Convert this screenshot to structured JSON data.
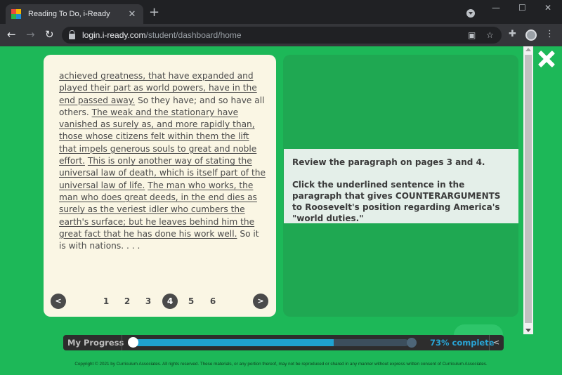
{
  "browser": {
    "tab_title": "Reading To Do, i-Ready",
    "tab_close": "✕",
    "new_tab": "+",
    "url_host": "login.i-ready.com",
    "url_path": "/student/dashboard/home",
    "window_controls": [
      "—",
      "☐",
      "✕"
    ]
  },
  "passage": {
    "segments": [
      {
        "text": "achieved greatness, that have expanded and played their part as world powers, have in the end passed away.",
        "underlined": true
      },
      {
        "text": " So they have; and so have all others. ",
        "underlined": false
      },
      {
        "text": "The weak and the stationary have vanished as surely as, and more rapidly than, those whose citizens felt within them the lift that impels generous souls to great and noble effort.",
        "underlined": true
      },
      {
        "text": " ",
        "underlined": false
      },
      {
        "text": "This is only another way of stating the universal law of death, which is itself part of the universal law of life.",
        "underlined": true
      },
      {
        "text": " ",
        "underlined": false
      },
      {
        "text": "The man who works, the man who does great deeds, in the end dies as surely as the veriest idler who cumbers the earth's surface; but he leaves behind him the great fact that he has done his work well.",
        "underlined": true
      },
      {
        "text": " So it is with nations. . . .",
        "underlined": false
      }
    ]
  },
  "pager": {
    "prev": "<",
    "next": ">",
    "pages": [
      "1",
      "2",
      "3",
      "4",
      "5",
      "6"
    ],
    "current": "4"
  },
  "question": {
    "line1": "Review the paragraph on pages 3 and 4.",
    "line2": "Click the underlined sentence in the paragraph that gives COUNTERARGUMENTS to Roosevelt's position regarding America's \"world duties.\""
  },
  "progress": {
    "label": "My Progress",
    "percent_text": "73% complete",
    "percent": 73,
    "collapse": "<",
    "fill_color": "#1fa3d0"
  },
  "footer": "Copyright © 2021 by Curriculum Associates. All rights reserved. These materials, or any portion thereof, may not be reproduced or shared in any manner without express written consent of Curriculum Associates.",
  "colors": {
    "page_bg": "#1db858",
    "card_bg": "#faf6e4",
    "panel_bg": "#1fa852",
    "question_bg": "#e4efe9"
  }
}
